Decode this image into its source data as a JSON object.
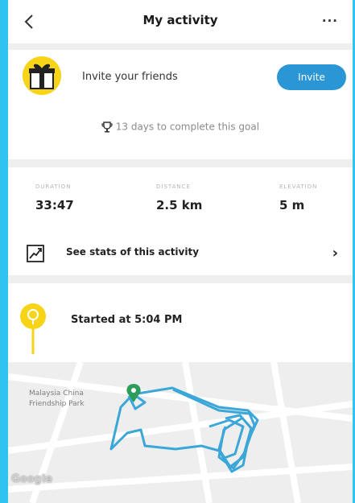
{
  "header": {
    "title": "My activity",
    "more_label": "···"
  },
  "invite": {
    "text": "Invite your friends",
    "button_label": "Invite"
  },
  "goal": {
    "text": "13 days to complete this goal"
  },
  "stats": [
    {
      "label": "DURATION",
      "value": "33:47"
    },
    {
      "label": "DISTANCE",
      "value": "2.5 km"
    },
    {
      "label": "ELEVATION",
      "value": "5 m"
    }
  ],
  "stats_link": {
    "label": "See stats of this activity",
    "chevron": "›"
  },
  "start": {
    "text": "Started at 5:04 PM"
  },
  "map": {
    "place_label": "Malaysia China\nFriendship Park",
    "attribution": "Google"
  },
  "icons": [
    "back-arrow-icon",
    "more-icon",
    "gift-icon",
    "trophy-icon",
    "chart-icon",
    "chevron-right-icon",
    "location-pin-icon",
    "map-marker-icon"
  ],
  "colors": {
    "accent": "#2a96d6",
    "route": "#3aa7d8",
    "pin": "#f7d417",
    "frame": "#2ec4ef"
  }
}
